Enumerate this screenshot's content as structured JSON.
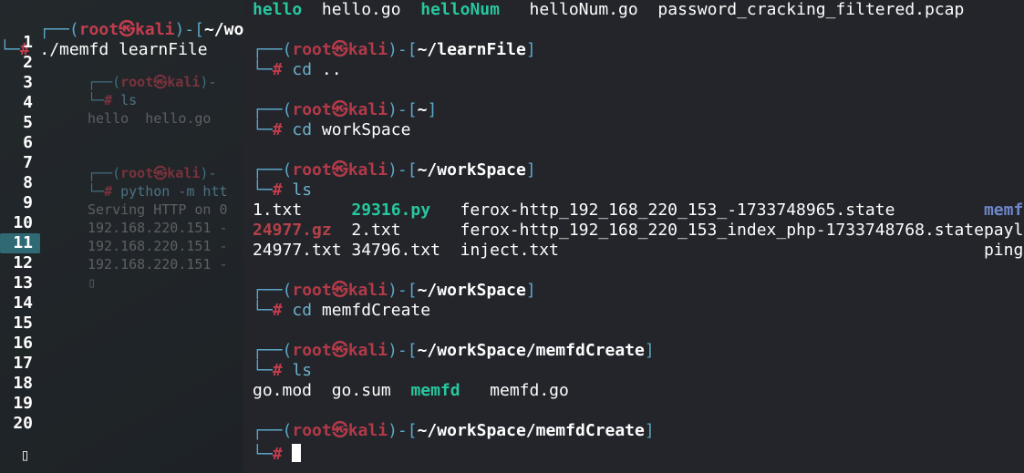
{
  "gutter": {
    "top_prompt_path": "~/workSpace",
    "top_cmd": "./memfd learnFile",
    "lines": [
      "1",
      "2",
      "3",
      "4",
      "5",
      "6",
      "7",
      "8",
      "9",
      "10",
      "11",
      "12",
      "13",
      "14",
      "15",
      "16",
      "17",
      "18",
      "19",
      "20"
    ],
    "overlay": {
      "ls_cmd": "ls",
      "ls_out": "hello  hello.go",
      "py_cmd": "python -m htt",
      "serve": "Serving HTTP on 0",
      "ip1": "192.168.220.151 -",
      "ip2": "192.168.220.151 -",
      "ip3": "192.168.220.151 -"
    }
  },
  "term": {
    "user": "root",
    "host": "kali",
    "skull": "㉿",
    "lines": [
      {
        "type": "ls_out0",
        "cells": [
          "hello",
          "  ",
          "hello.go",
          "  ",
          "helloNum",
          "   ",
          "helloNum.go",
          "  ",
          "password_cracking_filtered.pcap"
        ]
      },
      {
        "type": "blank"
      },
      {
        "type": "prompt1",
        "path": "~/learnFile"
      },
      {
        "type": "prompt2",
        "cmd": "cd ",
        "arg": ".."
      },
      {
        "type": "blank"
      },
      {
        "type": "prompt1",
        "path": "~"
      },
      {
        "type": "prompt2",
        "cmd": "cd ",
        "arg": "workSpace"
      },
      {
        "type": "blank"
      },
      {
        "type": "prompt1",
        "path": "~/workSpace"
      },
      {
        "type": "prompt2",
        "cmd": "ls",
        "arg": ""
      },
      {
        "type": "ls_col",
        "c1": "1.txt     ",
        "c2": "29316.py",
        "c2cls": "py",
        "c3": "   ",
        "c4": "ferox-http_192_168_220_153_-1733748965.state         ",
        "c5": "memfdCre",
        "c5cls": "dir"
      },
      {
        "type": "ls_col",
        "c1": "",
        "c1a": "24977.gz",
        "c1cls": "gz",
        "c1b": "  ",
        "c2": "2.txt   ",
        "c2cls": "plain",
        "c3": "   ",
        "c4": "ferox-http_192_168_220_153_index_php-1733748768.state",
        "c5": "payload.",
        "c5cls": "plain"
      },
      {
        "type": "ls_col",
        "c1": "24977.txt ",
        "c2": "34796.txt",
        "c2cls": "plain",
        "c3": "  ",
        "c4": "inject.txt                                           ",
        "c5": "ping.txt",
        "c5cls": "plain"
      },
      {
        "type": "blank"
      },
      {
        "type": "prompt1",
        "path": "~/workSpace"
      },
      {
        "type": "prompt2",
        "cmd": "cd ",
        "arg": "memfdCreate"
      },
      {
        "type": "blank"
      },
      {
        "type": "prompt1",
        "path": "~/workSpace/memfdCreate"
      },
      {
        "type": "prompt2",
        "cmd": "ls",
        "arg": ""
      },
      {
        "type": "ls_out1",
        "cells": [
          "go.mod",
          "  ",
          "go.sum",
          "  ",
          "memfd",
          "   ",
          "memfd.go"
        ]
      },
      {
        "type": "blank"
      },
      {
        "type": "prompt1",
        "path": "~/workSpace/memfdCreate"
      },
      {
        "type": "prompt2cursor"
      }
    ]
  }
}
